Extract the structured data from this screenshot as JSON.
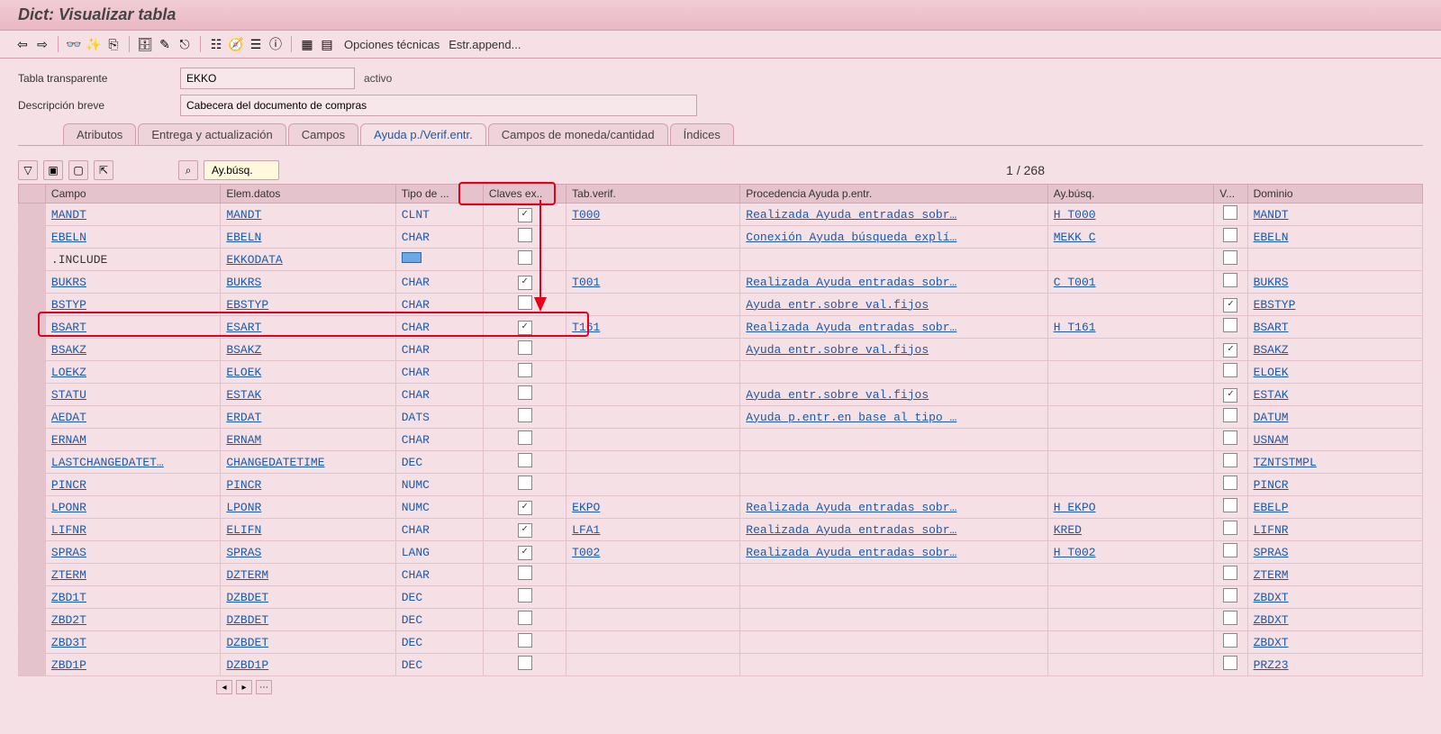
{
  "title": "Dict: Visualizar tabla",
  "toolbar_links": {
    "opciones": "Opciones técnicas",
    "append": "Estr.append..."
  },
  "header": {
    "label_transparente": "Tabla transparente",
    "value_transparente": "EKKO",
    "status": "activo",
    "label_desc": "Descripción breve",
    "value_desc": "Cabecera del documento de compras"
  },
  "tabs": {
    "atributos": "Atributos",
    "entrega": "Entrega y actualización",
    "campos": "Campos",
    "ayuda": "Ayuda p./Verif.entr.",
    "moneda": "Campos de moneda/cantidad",
    "indices": "Índices"
  },
  "grid_toolbar": {
    "search_help": "Ay.búsq."
  },
  "pager": {
    "text": "1  /  268"
  },
  "columns": {
    "campo": "Campo",
    "elem": "Elem.datos",
    "tipo": "Tipo de ...",
    "claves": "Claves ex..",
    "tabverif": "Tab.verif.",
    "proced": "Procedencia Ayuda p.entr.",
    "aybusq": "Ay.búsq.",
    "v": "V...",
    "dominio": "Dominio"
  },
  "rows": [
    {
      "campo": "MANDT",
      "elem": "MANDT",
      "tipo": "CLNT",
      "clave": true,
      "tabverif": "T000",
      "proced": "Realizada Ayuda entradas sobr…",
      "aybusq": "H_T000",
      "v": false,
      "dominio": "MANDT"
    },
    {
      "campo": "EBELN",
      "elem": "EBELN",
      "tipo": "CHAR",
      "clave": false,
      "tabverif": "",
      "proced": "Conexión Ayuda búsqueda explí…",
      "aybusq": "MEKK_C",
      "v": false,
      "dominio": "EBELN"
    },
    {
      "campo": ".INCLUDE",
      "elem": "EKKODATA",
      "tipo": "__struct__",
      "clave": false,
      "tabverif": "",
      "proced": "",
      "aybusq": "",
      "v": false,
      "dominio": ""
    },
    {
      "campo": "BUKRS",
      "elem": "BUKRS",
      "tipo": "CHAR",
      "clave": true,
      "tabverif": "T001",
      "proced": "Realizada Ayuda entradas sobr…",
      "aybusq": "C_T001",
      "v": false,
      "dominio": "BUKRS"
    },
    {
      "campo": "BSTYP",
      "elem": "EBSTYP",
      "tipo": "CHAR",
      "clave": false,
      "tabverif": "",
      "proced": "Ayuda entr.sobre val.fijos",
      "aybusq": "",
      "v": true,
      "dominio": "EBSTYP"
    },
    {
      "campo": "BSART",
      "elem": "ESART",
      "tipo": "CHAR",
      "clave": true,
      "tabverif": "T161",
      "proced": "Realizada Ayuda entradas sobr…",
      "aybusq": "H_T161",
      "v": false,
      "dominio": "BSART"
    },
    {
      "campo": "BSAKZ",
      "elem": "BSAKZ",
      "tipo": "CHAR",
      "clave": false,
      "tabverif": "",
      "proced": "Ayuda entr.sobre val.fijos",
      "aybusq": "",
      "v": true,
      "dominio": "BSAKZ"
    },
    {
      "campo": "LOEKZ",
      "elem": "ELOEK",
      "tipo": "CHAR",
      "clave": false,
      "tabverif": "",
      "proced": "",
      "aybusq": "",
      "v": false,
      "dominio": "ELOEK"
    },
    {
      "campo": "STATU",
      "elem": "ESTAK",
      "tipo": "CHAR",
      "clave": false,
      "tabverif": "",
      "proced": "Ayuda entr.sobre val.fijos",
      "aybusq": "",
      "v": true,
      "dominio": "ESTAK"
    },
    {
      "campo": "AEDAT",
      "elem": "ERDAT",
      "tipo": "DATS",
      "clave": false,
      "tabverif": "",
      "proced": "Ayuda p.entr.en base al tipo …",
      "aybusq": "",
      "v": false,
      "dominio": "DATUM"
    },
    {
      "campo": "ERNAM",
      "elem": "ERNAM",
      "tipo": "CHAR",
      "clave": false,
      "tabverif": "",
      "proced": "",
      "aybusq": "",
      "v": false,
      "dominio": "USNAM"
    },
    {
      "campo": "LASTCHANGEDATET…",
      "elem": "CHANGEDATETIME",
      "tipo": "DEC",
      "clave": false,
      "tabverif": "",
      "proced": "",
      "aybusq": "",
      "v": false,
      "dominio": "TZNTSTMPL"
    },
    {
      "campo": "PINCR",
      "elem": "PINCR",
      "tipo": "NUMC",
      "clave": false,
      "tabverif": "",
      "proced": "",
      "aybusq": "",
      "v": false,
      "dominio": "PINCR"
    },
    {
      "campo": "LPONR",
      "elem": "LPONR",
      "tipo": "NUMC",
      "clave": true,
      "tabverif": "EKPO",
      "proced": "Realizada Ayuda entradas sobr…",
      "aybusq": "H_EKPO",
      "v": false,
      "dominio": "EBELP"
    },
    {
      "campo": "LIFNR",
      "elem": "ELIFN",
      "tipo": "CHAR",
      "clave": true,
      "tabverif": "LFA1",
      "proced": "Realizada Ayuda entradas sobr…",
      "aybusq": "KRED",
      "v": false,
      "dominio": "LIFNR"
    },
    {
      "campo": "SPRAS",
      "elem": "SPRAS",
      "tipo": "LANG",
      "clave": true,
      "tabverif": "T002",
      "proced": "Realizada Ayuda entradas sobr…",
      "aybusq": "H_T002",
      "v": false,
      "dominio": "SPRAS"
    },
    {
      "campo": "ZTERM",
      "elem": "DZTERM",
      "tipo": "CHAR",
      "clave": false,
      "tabverif": "",
      "proced": "",
      "aybusq": "",
      "v": false,
      "dominio": "ZTERM"
    },
    {
      "campo": "ZBD1T",
      "elem": "DZBDET",
      "tipo": "DEC",
      "clave": false,
      "tabverif": "",
      "proced": "",
      "aybusq": "",
      "v": false,
      "dominio": "ZBDXT"
    },
    {
      "campo": "ZBD2T",
      "elem": "DZBDET",
      "tipo": "DEC",
      "clave": false,
      "tabverif": "",
      "proced": "",
      "aybusq": "",
      "v": false,
      "dominio": "ZBDXT"
    },
    {
      "campo": "ZBD3T",
      "elem": "DZBDET",
      "tipo": "DEC",
      "clave": false,
      "tabverif": "",
      "proced": "",
      "aybusq": "",
      "v": false,
      "dominio": "ZBDXT"
    },
    {
      "campo": "ZBD1P",
      "elem": "DZBD1P",
      "tipo": "DEC",
      "clave": false,
      "tabverif": "",
      "proced": "",
      "aybusq": "",
      "v": false,
      "dominio": "PRZ23"
    }
  ],
  "icons": {
    "back": "⇦",
    "fwd": "⇨",
    "glasses": "👓",
    "wand": "✨",
    "copy": "⎘",
    "db": "🗄",
    "pencil": "✎",
    "exit": "⎋",
    "hier": "☷",
    "nav": "🧭",
    "list": "☰",
    "info": "ⓘ",
    "grid1": "▦",
    "grid2": "▤"
  }
}
